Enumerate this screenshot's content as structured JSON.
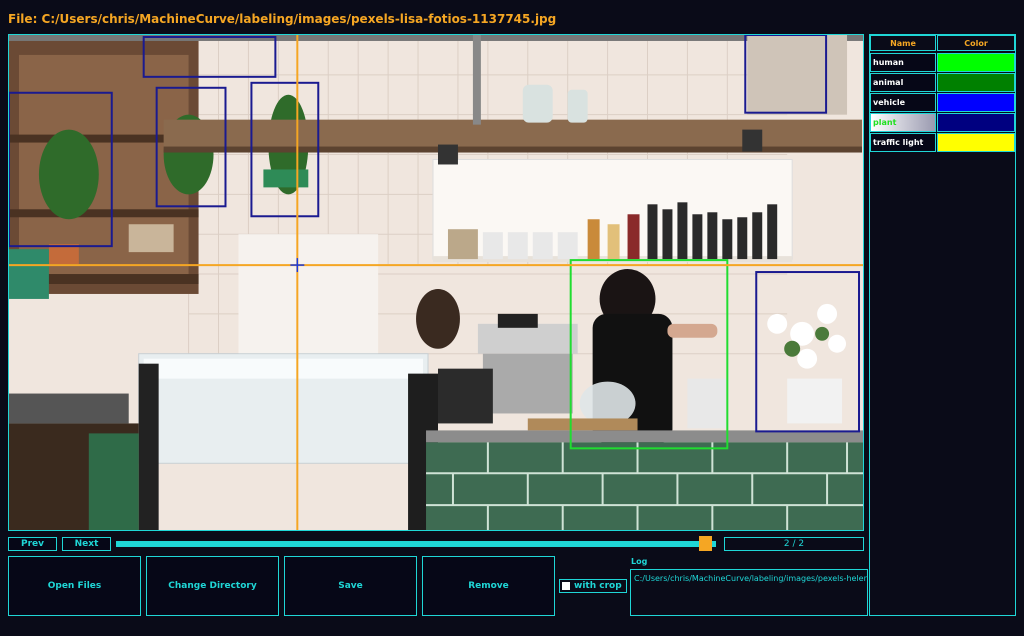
{
  "file_title": "File: C:/Users/chris/MachineCurve/labeling/images/pexels-lisa-fotios-1137745.jpg",
  "nav": {
    "prev_label": "Prev",
    "next_label": "Next"
  },
  "progress": {
    "current": 2,
    "total": 2,
    "fraction": 1.0,
    "text": "2 / 2"
  },
  "actions": {
    "open_files": "Open Files",
    "change_directory": "Change Directory",
    "save": "Save",
    "remove": "Remove",
    "with_crop": "with crop"
  },
  "log": {
    "label": "Log",
    "line": "C:/Users/chris/MachineCurve/labeling/images/pexels-helena-lo"
  },
  "labels_table": {
    "header_name": "Name",
    "header_color": "Color",
    "rows": [
      {
        "name": "human",
        "color": "#00ff00",
        "selected": false
      },
      {
        "name": "animal",
        "color": "#008000",
        "selected": false
      },
      {
        "name": "vehicle",
        "color": "#0000ff",
        "selected": false
      },
      {
        "name": "plant",
        "color": "#000080",
        "selected": true
      },
      {
        "name": "traffic light",
        "color": "#ffff00",
        "selected": false
      }
    ]
  },
  "colors": {
    "accent": "#1fd6d6",
    "title": "#f5a623",
    "background": "#0a0b18",
    "crosshair": "#f5a623"
  }
}
